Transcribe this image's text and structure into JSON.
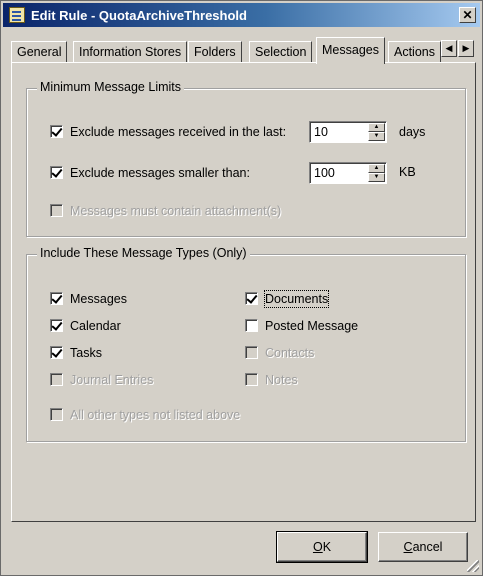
{
  "window": {
    "title": "Edit Rule - QuotaArchiveThreshold",
    "close_glyph": "✕"
  },
  "tabs": [
    {
      "label": "General",
      "active": false
    },
    {
      "label": "Information Stores",
      "active": false
    },
    {
      "label": "Folders",
      "active": false
    },
    {
      "label": "Selection",
      "active": false
    },
    {
      "label": "Messages",
      "active": true
    },
    {
      "label": "Actions",
      "active": false
    }
  ],
  "tab_scroll": {
    "left": "◀",
    "right": "▶"
  },
  "limits": {
    "title": "Minimum Message Limits",
    "received": {
      "label": "Exclude messages received in the last:",
      "checked": true,
      "value": "10",
      "unit": "days"
    },
    "smaller": {
      "label": "Exclude messages smaller than:",
      "checked": true,
      "value": "100",
      "unit": "KB"
    },
    "attachment": {
      "label": "Messages must contain attachment(s)",
      "checked": false,
      "disabled": true
    }
  },
  "types": {
    "title": "Include These Message Types (Only)",
    "messages": {
      "label": "Messages",
      "checked": true
    },
    "calendar": {
      "label": "Calendar",
      "checked": true
    },
    "tasks": {
      "label": "Tasks",
      "checked": true
    },
    "journal": {
      "label": "Journal Entries",
      "checked": false,
      "disabled": true
    },
    "documents": {
      "label": "Documents",
      "checked": true
    },
    "posted": {
      "label": "Posted Message",
      "checked": false
    },
    "contacts": {
      "label": "Contacts",
      "checked": false,
      "disabled": true
    },
    "notes": {
      "label": "Notes",
      "checked": false,
      "disabled": true
    },
    "other": {
      "label": "All other types not listed above",
      "checked": false,
      "disabled": true
    }
  },
  "buttons": {
    "ok": {
      "key": "O",
      "rest": "K"
    },
    "cancel": {
      "key": "C",
      "rest": "ancel"
    }
  },
  "spin": {
    "up": "▲",
    "down": "▼"
  }
}
